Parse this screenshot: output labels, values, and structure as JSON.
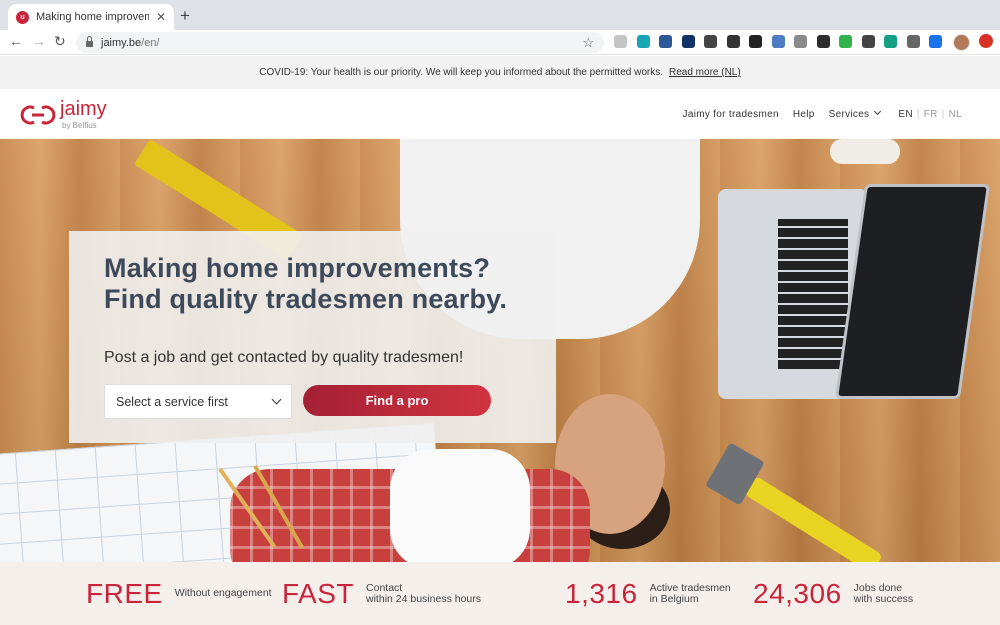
{
  "browser": {
    "tab_title": "Making home improvements? F",
    "new_tab": "+",
    "close": "✕",
    "url_host": "jaimy.be",
    "url_path": "/en/",
    "extension_colors": [
      "#c5c5c5",
      "#1aa6b7",
      "#2b5797",
      "#113366",
      "#444444",
      "#333333",
      "#222222",
      "#4d7cc0",
      "#8a8a8a",
      "#2c2c2c",
      "#2fb34a",
      "#444444",
      "#15a085",
      "#666666",
      "#1a73e8"
    ]
  },
  "banner": {
    "text": "COVID-19: Your health is our priority. We will keep you informed about the permitted works.",
    "link": "Read more (NL)"
  },
  "header": {
    "logo_word": "jaimy",
    "logo_sub": "by Belfius",
    "nav": {
      "tradesmen": "Jaimy for tradesmen",
      "help": "Help",
      "services": "Services"
    },
    "lang": {
      "en": "EN",
      "fr": "FR",
      "nl": "NL",
      "sep": "|"
    },
    "brand_color": "#c8253b"
  },
  "hero": {
    "title": "Making home improvements? Find quality tradesmen nearby.",
    "subtitle": "Post a job and get contacted by quality tradesmen!",
    "select_value": "Select a service first",
    "cta": "Find a pro"
  },
  "stats": [
    {
      "big": "FREE",
      "line1": "Without engagement",
      "line2": ""
    },
    {
      "big": "FAST",
      "line1": "Contact",
      "line2": "within 24 business hours"
    },
    {
      "big": "1,316",
      "line1": "Active tradesmen",
      "line2": "in Belgium"
    },
    {
      "big": "24,306",
      "line1": "Jobs done",
      "line2": "with success"
    }
  ]
}
